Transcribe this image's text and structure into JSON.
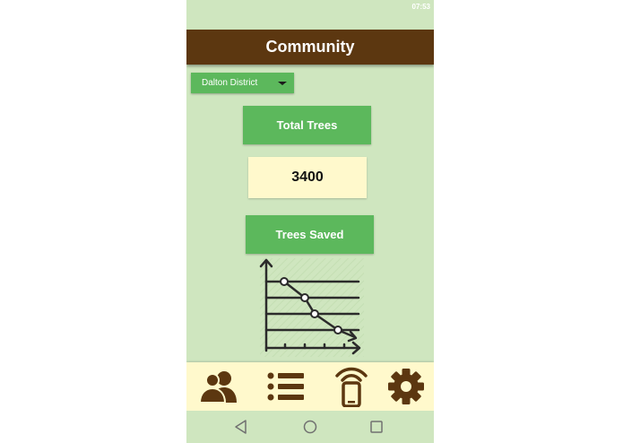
{
  "status_bar": {
    "time": "07:53"
  },
  "app_bar": {
    "title": "Community"
  },
  "district_select": {
    "selected": "Dalton District"
  },
  "total_trees": {
    "button_label": "Total Trees",
    "value": "3400"
  },
  "trees_saved": {
    "button_label": "Trees Saved"
  },
  "chart_icon": {
    "icon": "declining-line-graph-icon"
  },
  "bottom_nav": {
    "items": [
      {
        "icon": "people-icon"
      },
      {
        "icon": "list-icon"
      },
      {
        "icon": "phone-signal-icon"
      },
      {
        "icon": "gear-icon"
      }
    ]
  },
  "android_nav": {
    "back": "back-icon",
    "home": "home-icon",
    "recents": "recents-icon"
  },
  "colors": {
    "background": "#cfe6bf",
    "app_bar": "#5c3710",
    "button_green": "#5cb85c",
    "value_box": "#fff9cc",
    "icon_brown": "#5c3710"
  }
}
